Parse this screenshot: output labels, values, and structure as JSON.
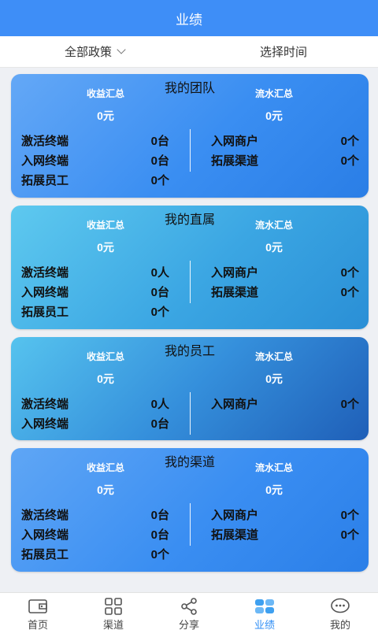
{
  "header": {
    "title": "业绩"
  },
  "filters": {
    "policy_label": "全部政策",
    "time_label": "选择时间"
  },
  "cards": [
    {
      "title": "我的团队",
      "income_label": "收益汇总",
      "income_value": "0元",
      "flow_label": "流水汇总",
      "flow_value": "0元",
      "left_rows": [
        {
          "label": "激活终端",
          "value": "0台"
        },
        {
          "label": "入网终端",
          "value": "0台"
        },
        {
          "label": "拓展员工",
          "value": "0个"
        }
      ],
      "right_rows": [
        {
          "label": "入网商户",
          "value": "0个"
        },
        {
          "label": "拓展渠道",
          "value": "0个"
        }
      ]
    },
    {
      "title": "我的直属",
      "income_label": "收益汇总",
      "income_value": "0元",
      "flow_label": "流水汇总",
      "flow_value": "0元",
      "left_rows": [
        {
          "label": "激活终端",
          "value": "0人"
        },
        {
          "label": "入网终端",
          "value": "0台"
        },
        {
          "label": "拓展员工",
          "value": "0个"
        }
      ],
      "right_rows": [
        {
          "label": "入网商户",
          "value": "0个"
        },
        {
          "label": "拓展渠道",
          "value": "0个"
        }
      ]
    },
    {
      "title": "我的员工",
      "income_label": "收益汇总",
      "income_value": "0元",
      "flow_label": "流水汇总",
      "flow_value": "0元",
      "left_rows": [
        {
          "label": "激活终端",
          "value": "0人"
        },
        {
          "label": "入网终端",
          "value": "0台"
        }
      ],
      "right_rows": [
        {
          "label": "入网商户",
          "value": "0个"
        }
      ]
    },
    {
      "title": "我的渠道",
      "income_label": "收益汇总",
      "income_value": "0元",
      "flow_label": "流水汇总",
      "flow_value": "0元",
      "left_rows": [
        {
          "label": "激活终端",
          "value": "0台"
        },
        {
          "label": "入网终端",
          "value": "0台"
        },
        {
          "label": "拓展员工",
          "value": "0个"
        }
      ],
      "right_rows": [
        {
          "label": "入网商户",
          "value": "0个"
        },
        {
          "label": "拓展渠道",
          "value": "0个"
        }
      ]
    }
  ],
  "nav": [
    {
      "label": "首页",
      "icon": "wallet-icon",
      "active": false
    },
    {
      "label": "渠道",
      "icon": "grid-icon",
      "active": false
    },
    {
      "label": "分享",
      "icon": "share-icon",
      "active": false
    },
    {
      "label": "业绩",
      "icon": "performance-icon",
      "active": true
    },
    {
      "label": "我的",
      "icon": "chat-icon",
      "active": false
    }
  ],
  "colors": {
    "header": "#3e8ef7",
    "card_team": "#3c8df3",
    "card_direct": "#3aa7e6",
    "card_staff": "#2a77d2",
    "card_channel": "#3a8ef3",
    "nav_active": "#2f8ef5"
  }
}
